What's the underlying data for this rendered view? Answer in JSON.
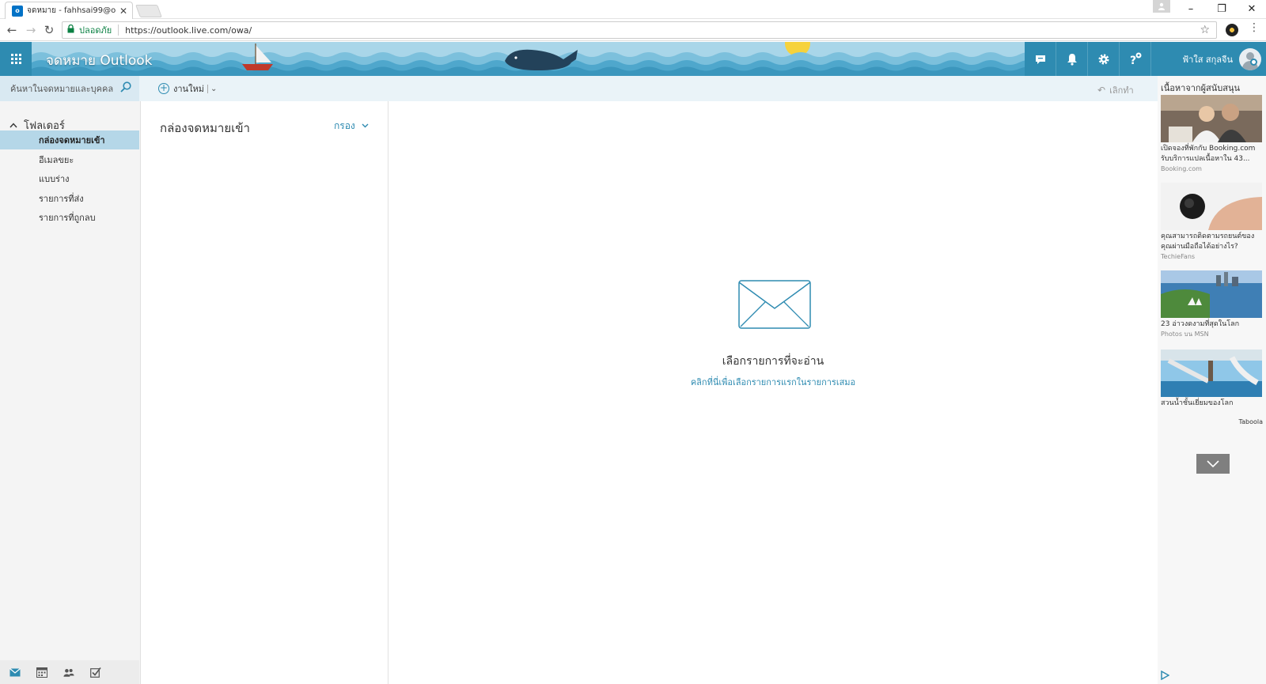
{
  "browser": {
    "tab_title": "จดหมาย - fahhsai99@out",
    "tab_favicon_label": "o",
    "secure_label": "ปลอดภัย",
    "url": "https://outlook.live.com/owa/"
  },
  "header": {
    "brand": "จดหมาย Outlook",
    "user_name": "ฟ้าใส สกุลจีน"
  },
  "search": {
    "placeholder": "ค้นหาในจดหมายและบุคคล"
  },
  "commands": {
    "new_label": "งานใหม่",
    "undo_label": "เลิกทำ"
  },
  "folders": {
    "header": "โฟลเดอร์",
    "items": [
      {
        "label": "กล่องจดหมายเข้า",
        "active": true
      },
      {
        "label": "อีเมลขยะ"
      },
      {
        "label": "แบบร่าง"
      },
      {
        "label": "รายการที่ส่ง"
      },
      {
        "label": "รายการที่ถูกลบ"
      }
    ]
  },
  "message_list": {
    "title": "กล่องจดหมายเข้า",
    "filter_label": "กรอง"
  },
  "reading_pane": {
    "empty_title": "เลือกรายการที่จะอ่าน",
    "empty_link": "คลิกที่นี่เพื่อเลือกรายการแรกในรายการเสมอ"
  },
  "ads": {
    "header": "เนื้อหาจากผู้สนับสนุน",
    "items": [
      {
        "caption": "เปิดจองที่พักกับ Booking.com รับบริการแปลเนื้อหาใน 43...",
        "source": "Booking.com"
      },
      {
        "caption": "คุณสามารถติดตามรถยนต์ของคุณผ่านมือถือได้อย่างไร?",
        "source": "TechieFans"
      },
      {
        "caption": "23 อ่าวงดงามที่สุดในโลก",
        "source": "Photos บน MSN"
      },
      {
        "caption": "สวนน้ำชั้นเยี่ยมของโลก",
        "source": ""
      }
    ],
    "brand": "Taboola"
  },
  "colors": {
    "accent": "#2e8bb1",
    "selected_folder": "#b5d7e8",
    "theme_sky": "#a9d6e9"
  }
}
